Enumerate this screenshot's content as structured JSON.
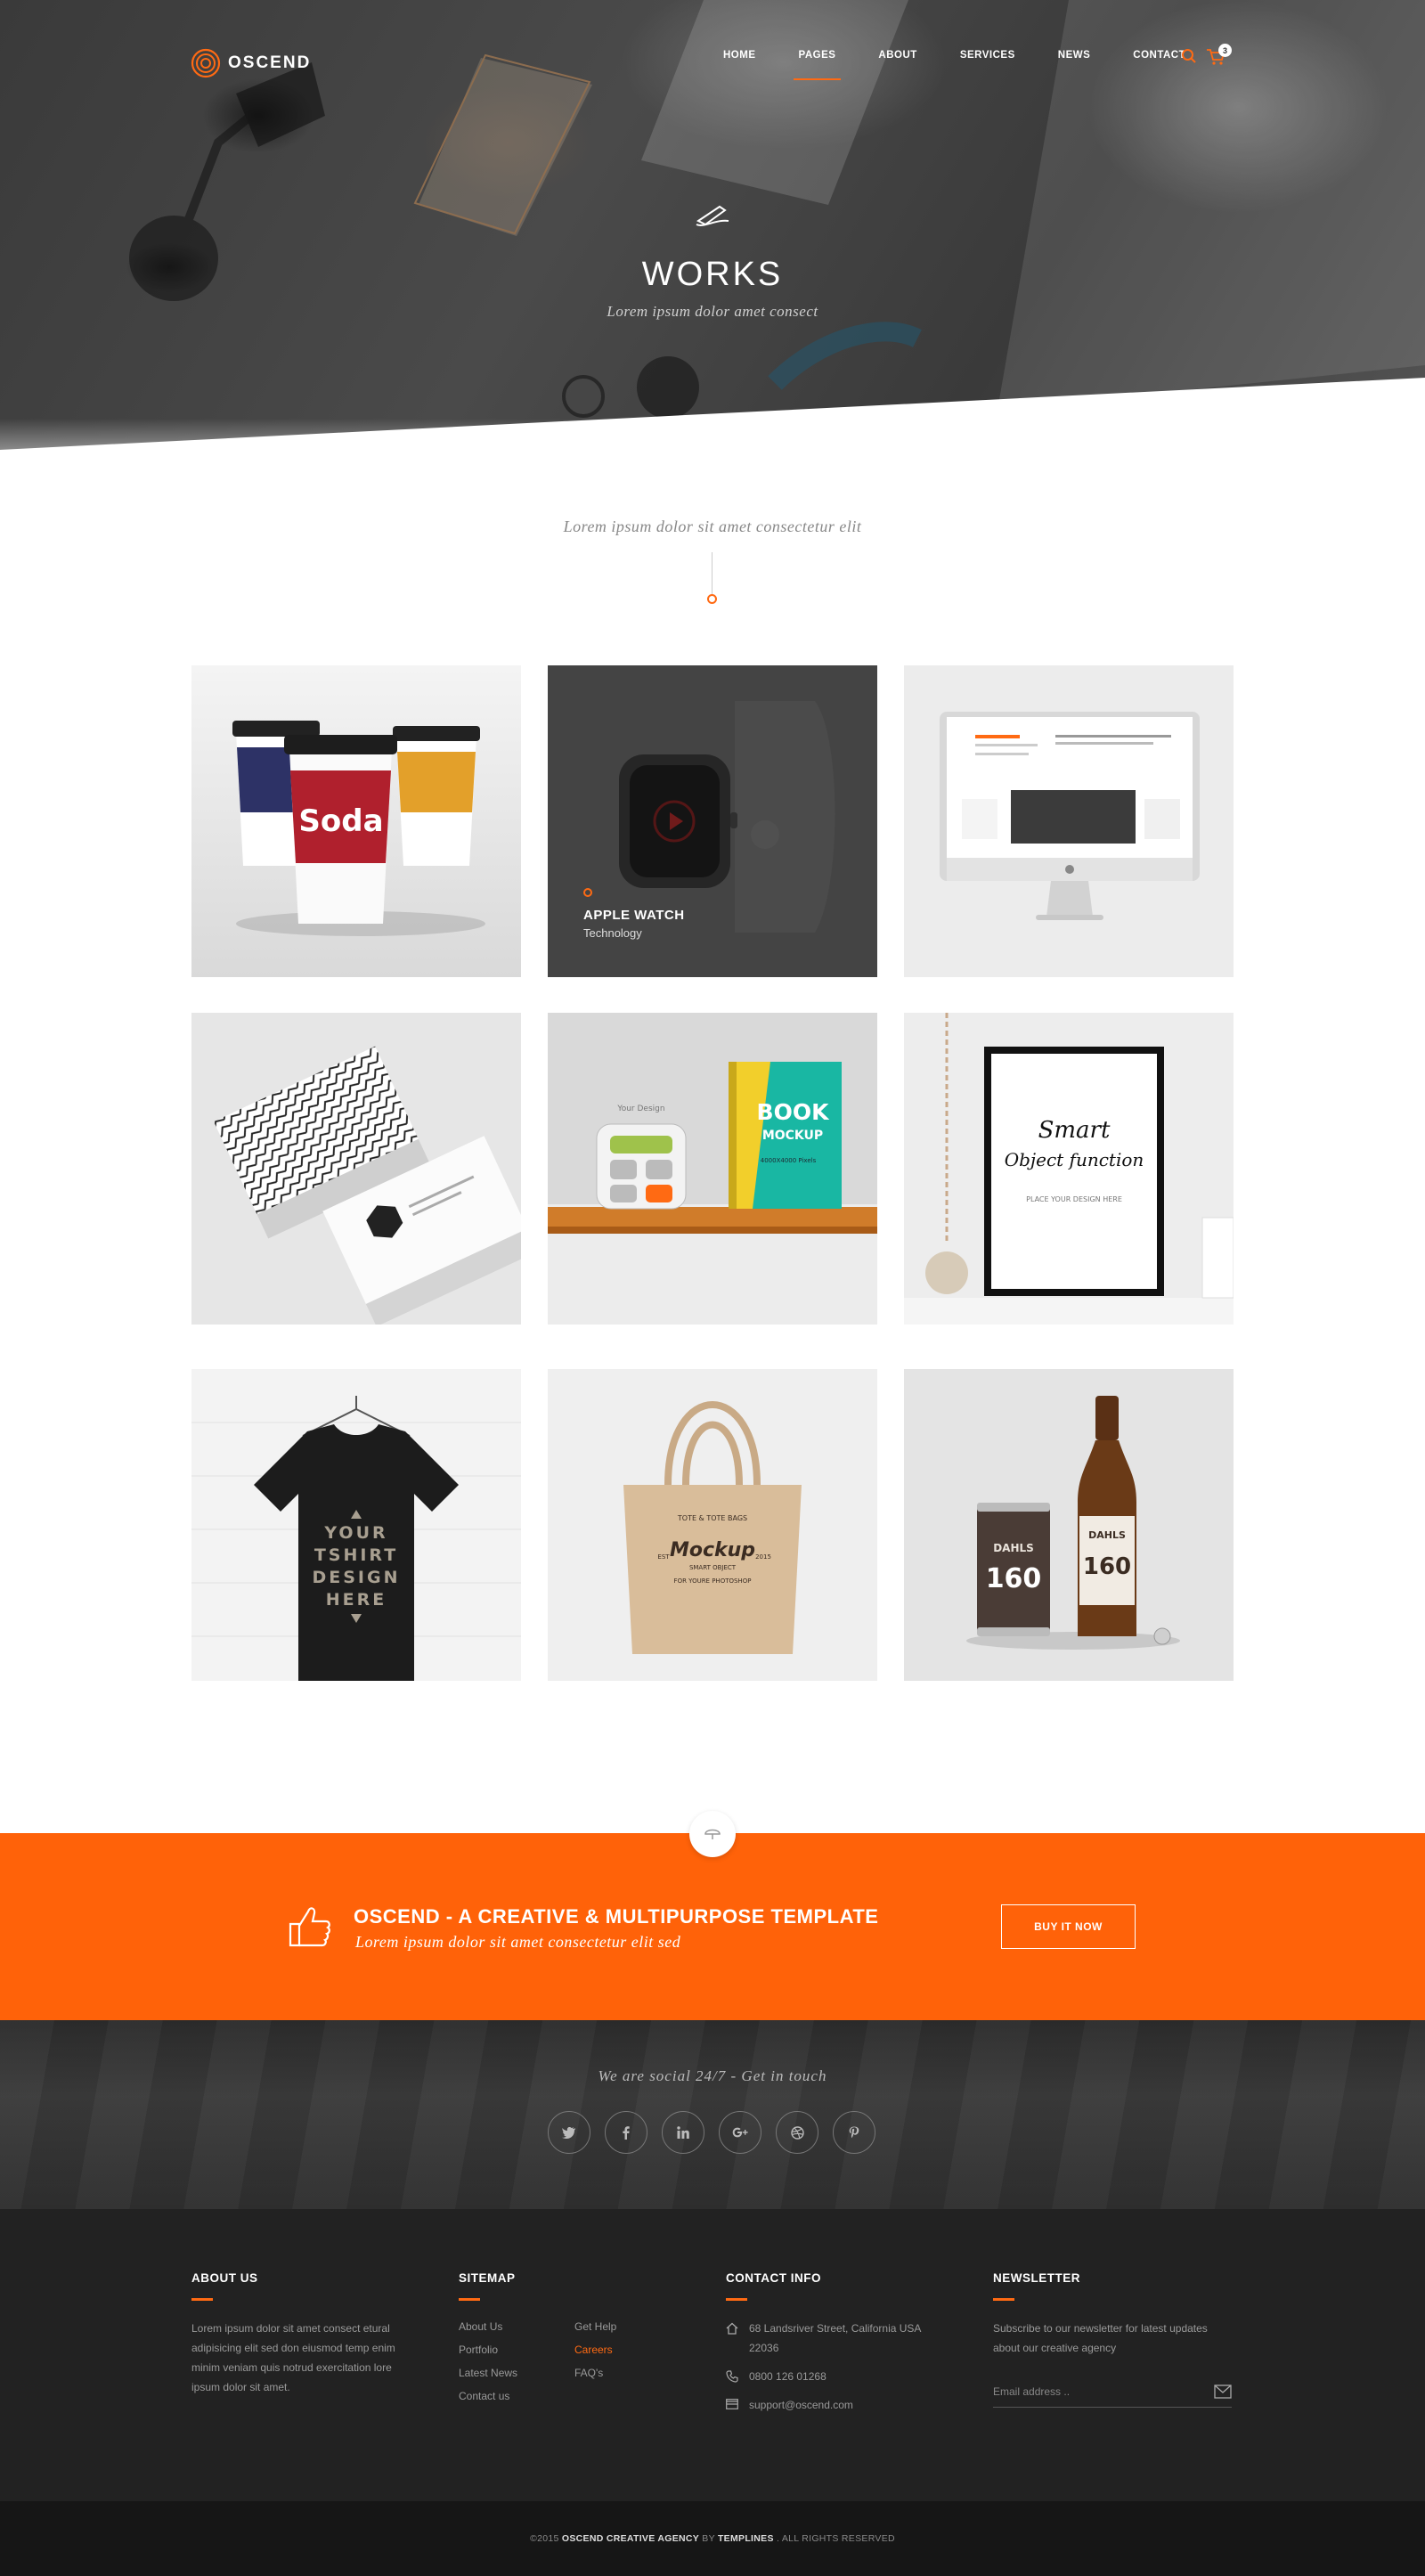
{
  "brand": {
    "name": "OSCEND",
    "accent": "#ff6209"
  },
  "nav": {
    "items": [
      "HOME",
      "PAGES",
      "ABOUT",
      "SERVICES",
      "NEWS",
      "CONTACT"
    ],
    "active": "PAGES",
    "cart_count": "3"
  },
  "hero": {
    "title": "WORKS",
    "subtitle": "Lorem ipsum dolor amet consect"
  },
  "intro": {
    "text": "Lorem ipsum dolor sit amet consectetur elit"
  },
  "portfolio": {
    "featured": {
      "title": "APPLE WATCH",
      "category": "Technology"
    },
    "tiles": [
      {
        "name": "soda-cups"
      },
      {
        "name": "apple-watch"
      },
      {
        "name": "imac-website"
      },
      {
        "name": "business-cards"
      },
      {
        "name": "book-mockup",
        "book_line1": "BOOK",
        "book_line2": "MOCKUP",
        "book_note": "4000X4000 Pixels",
        "screen_text": "Your Design"
      },
      {
        "name": "smart-frame",
        "frame_line1": "Smart",
        "frame_line2": "Object function",
        "frame_note": "PLACE YOUR DESIGN HERE"
      },
      {
        "name": "tshirt",
        "shirt_lines": [
          "YOUR",
          "TSHIRT",
          "DESIGN",
          "HERE"
        ]
      },
      {
        "name": "tote-bag",
        "bag_top": "TOTE & TOTE BAGS",
        "bag_main": "Mockup",
        "bag_sub": "SMART OBJECT",
        "bag_bottom": "FOR YOURE PHOTOSHOP",
        "bag_est": "EST",
        "bag_year": "2015"
      },
      {
        "name": "beer",
        "brand": "DAHLS",
        "number": "160"
      }
    ],
    "soda_text": "Soda"
  },
  "cta": {
    "title": "OSCEND - A CREATIVE & MULTIPURPOSE TEMPLATE",
    "subtitle": "Lorem ipsum dolor sit amet consectetur elit sed",
    "button": "BUY IT NOW"
  },
  "social": {
    "text": "We are social 24/7 - Get in touch",
    "icons": [
      "twitter-icon",
      "facebook-icon",
      "linkedin-icon",
      "google-plus-icon",
      "dribbble-icon",
      "pinterest-icon"
    ]
  },
  "footer": {
    "about": {
      "heading": "ABOUT US",
      "text": "Lorem ipsum dolor sit amet consect etural adipisicing elit sed don eiusmod temp enim minim veniam quis notrud exercitation lore ipsum dolor sit amet."
    },
    "sitemap": {
      "heading": "SITEMAP",
      "col1": [
        "About Us",
        "Portfolio",
        "Latest News",
        "Contact us"
      ],
      "col2": [
        "Get Help",
        "Careers",
        "FAQ's"
      ],
      "highlight": "Careers"
    },
    "contact": {
      "heading": "CONTACT INFO",
      "address": "68 Landsriver Street, California USA 22036",
      "phone": "0800 126 01268",
      "email": "support@oscend.com"
    },
    "newsletter": {
      "heading": "NEWSLETTER",
      "text": "Subscribe to our newsletter for latest updates about our creative agency",
      "placeholder": "Email address .."
    }
  },
  "copyright": {
    "prefix": "©2015 ",
    "agency": "OSCEND CREATIVE AGENCY",
    "by": " BY ",
    "brand": "TEMPLINES",
    "suffix": " . ALL RIGHTS RESERVED"
  }
}
